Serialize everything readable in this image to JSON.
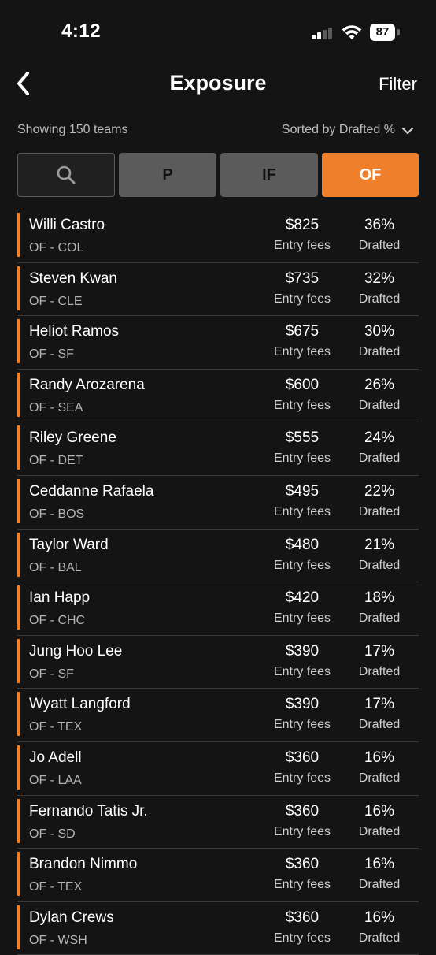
{
  "status_bar": {
    "time": "4:12",
    "battery": "87"
  },
  "nav": {
    "title": "Exposure",
    "filter_label": "Filter"
  },
  "info": {
    "showing": "Showing 150 teams",
    "sort": "Sorted by Drafted %"
  },
  "tabs": [
    {
      "label": ""
    },
    {
      "label": "P"
    },
    {
      "label": "IF"
    },
    {
      "label": "OF"
    }
  ],
  "accent_color": "#ef7f2a",
  "players": [
    {
      "name": "Willi Castro",
      "pos": "OF - COL",
      "fee": "$825",
      "fee_label": "Entry fees",
      "pct": "36%",
      "pct_label": "Drafted"
    },
    {
      "name": "Steven Kwan",
      "pos": "OF - CLE",
      "fee": "$735",
      "fee_label": "Entry fees",
      "pct": "32%",
      "pct_label": "Drafted"
    },
    {
      "name": "Heliot Ramos",
      "pos": "OF - SF",
      "fee": "$675",
      "fee_label": "Entry fees",
      "pct": "30%",
      "pct_label": "Drafted"
    },
    {
      "name": "Randy Arozarena",
      "pos": "OF - SEA",
      "fee": "$600",
      "fee_label": "Entry fees",
      "pct": "26%",
      "pct_label": "Drafted"
    },
    {
      "name": "Riley Greene",
      "pos": "OF - DET",
      "fee": "$555",
      "fee_label": "Entry fees",
      "pct": "24%",
      "pct_label": "Drafted"
    },
    {
      "name": "Ceddanne Rafaela",
      "pos": "OF - BOS",
      "fee": "$495",
      "fee_label": "Entry fees",
      "pct": "22%",
      "pct_label": "Drafted"
    },
    {
      "name": "Taylor Ward",
      "pos": "OF - BAL",
      "fee": "$480",
      "fee_label": "Entry fees",
      "pct": "21%",
      "pct_label": "Drafted"
    },
    {
      "name": "Ian Happ",
      "pos": "OF - CHC",
      "fee": "$420",
      "fee_label": "Entry fees",
      "pct": "18%",
      "pct_label": "Drafted"
    },
    {
      "name": "Jung Hoo Lee",
      "pos": "OF - SF",
      "fee": "$390",
      "fee_label": "Entry fees",
      "pct": "17%",
      "pct_label": "Drafted"
    },
    {
      "name": "Wyatt Langford",
      "pos": "OF - TEX",
      "fee": "$390",
      "fee_label": "Entry fees",
      "pct": "17%",
      "pct_label": "Drafted"
    },
    {
      "name": "Jo Adell",
      "pos": "OF - LAA",
      "fee": "$360",
      "fee_label": "Entry fees",
      "pct": "16%",
      "pct_label": "Drafted"
    },
    {
      "name": "Fernando Tatis Jr.",
      "pos": "OF - SD",
      "fee": "$360",
      "fee_label": "Entry fees",
      "pct": "16%",
      "pct_label": "Drafted"
    },
    {
      "name": "Brandon Nimmo",
      "pos": "OF - TEX",
      "fee": "$360",
      "fee_label": "Entry fees",
      "pct": "16%",
      "pct_label": "Drafted"
    },
    {
      "name": "Dylan Crews",
      "pos": "OF - WSH",
      "fee": "$360",
      "fee_label": "Entry fees",
      "pct": "16%",
      "pct_label": "Drafted"
    }
  ]
}
